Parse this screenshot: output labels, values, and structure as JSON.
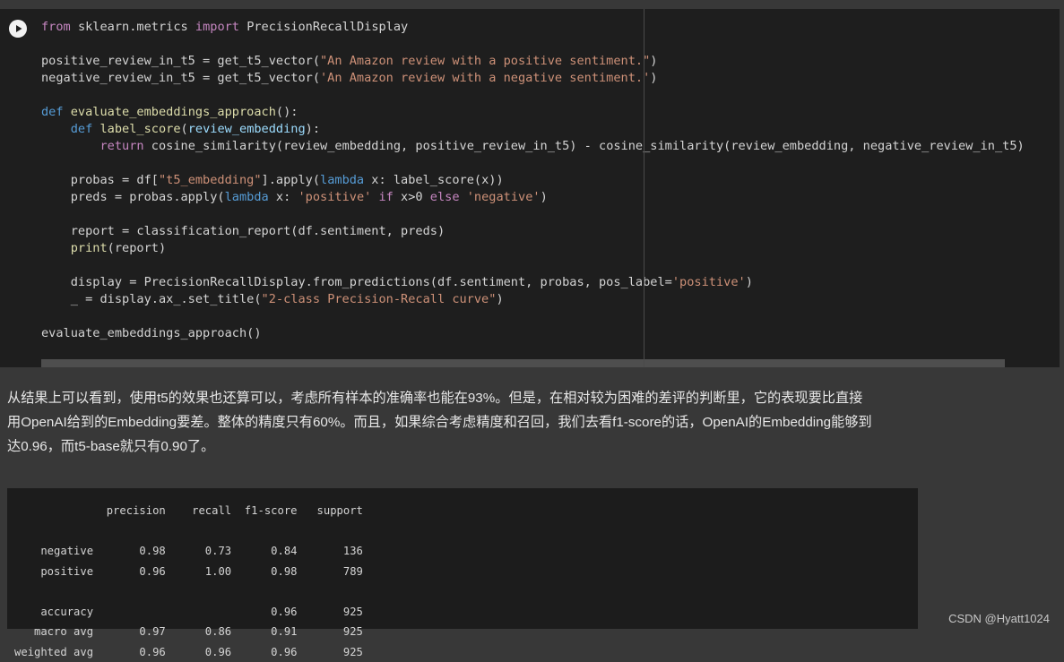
{
  "code_cell": {
    "lines": [
      "from sklearn.metrics import PrecisionRecallDisplay",
      "",
      "positive_review_in_t5 = get_t5_vector(\"An Amazon review with a positive sentiment.\")",
      "negative_review_in_t5 = get_t5_vector('An Amazon review with a negative sentiment.')",
      "",
      "def evaluate_embeddings_approach():",
      "    def label_score(review_embedding):",
      "        return cosine_similarity(review_embedding, positive_review_in_t5) - cosine_similarity(review_embedding, negative_review_in_t5)",
      "",
      "    probas = df[\"t5_embedding\"].apply(lambda x: label_score(x))",
      "    preds = probas.apply(lambda x: 'positive' if x>0 else 'negative')",
      "",
      "    report = classification_report(df.sentiment, preds)",
      "    print(report)",
      "",
      "    display = PrecisionRecallDisplay.from_predictions(df.sentiment, probas, pos_label='positive')",
      "    _ = display.ax_.set_title(\"2-class Precision-Recall curve\")",
      "",
      "evaluate_embeddings_approach()"
    ]
  },
  "markdown": {
    "line1": "从结果上可以看到，使用t5的效果也还算可以，考虑所有样本的准确率也能在93%。但是，在相对较为困难的差评的判断里，它的表现要比直接",
    "line2": "用OpenAI给到的Embedding要差。整体的精度只有60%。而且，如果综合考虑精度和召回，我们去看f1-score的话，OpenAI的Embedding能够到",
    "line3": "达0.96，而t5-base就只有0.90了。"
  },
  "output": {
    "lines": [
      "              precision    recall  f1-score   support",
      "",
      "    negative       0.98      0.73      0.84       136",
      "    positive       0.96      1.00      0.98       789",
      "",
      "    accuracy                           0.96       925",
      "   macro avg       0.97      0.86      0.91       925",
      "weighted avg       0.96      0.96      0.96       925"
    ]
  },
  "watermark": "CSDN @Hyatt1024"
}
